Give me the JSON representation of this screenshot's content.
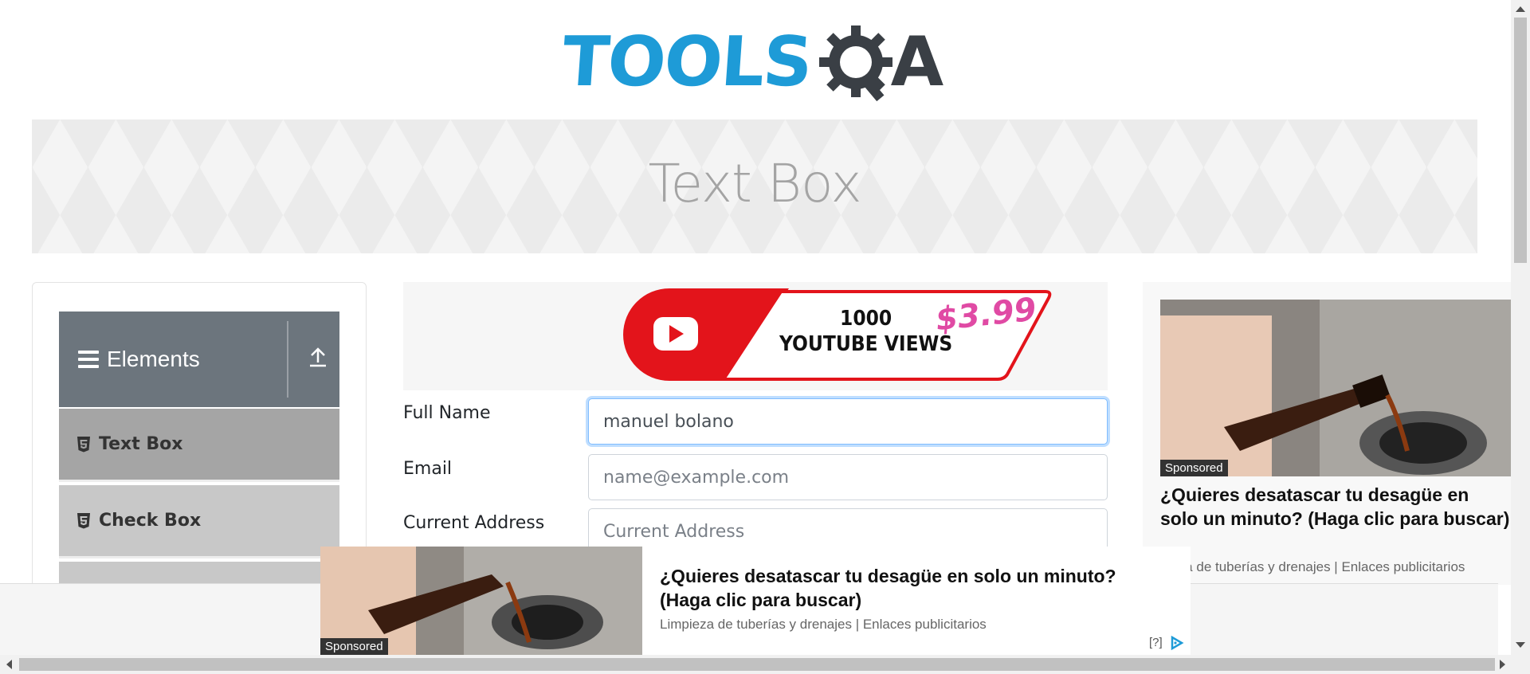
{
  "header": {
    "logo_text_primary": "TOOLS",
    "logo_text_secondary": "A",
    "banner_title": "Text Box"
  },
  "sidebar": {
    "group_title": "Elements",
    "items": [
      {
        "label": "Text Box",
        "icon": "html5-icon"
      },
      {
        "label": "Check Box",
        "icon": "html5-icon"
      }
    ]
  },
  "center_ad": {
    "line1": "1000",
    "line2": "YOUTUBE VIEWS",
    "price": "$3.99"
  },
  "form": {
    "full_name_label": "Full Name",
    "full_name_value": "manuel bolano",
    "email_label": "Email",
    "email_placeholder": "name@example.com",
    "address_label": "Current Address",
    "address_placeholder": "Current Address"
  },
  "right_ad": {
    "sponsored": "Sponsored",
    "title": "¿Quieres desatascar tu desagüe en solo un minuto? (Haga clic para buscar)",
    "subtitle": "pieza de tuberías y drenajes | Enlaces publicitarios"
  },
  "bottom_ad": {
    "sponsored": "Sponsored",
    "title": "¿Quieres desatascar tu desagüe en solo un minuto? (Haga clic para buscar)",
    "subtitle": "Limpieza de tuberías y drenajes | Enlaces publicitarios",
    "adchoices_q": "[?]"
  },
  "colors": {
    "brand_blue": "#1e9bd7",
    "sidebar_header": "#6c757d",
    "focus_border": "#80bdff"
  }
}
